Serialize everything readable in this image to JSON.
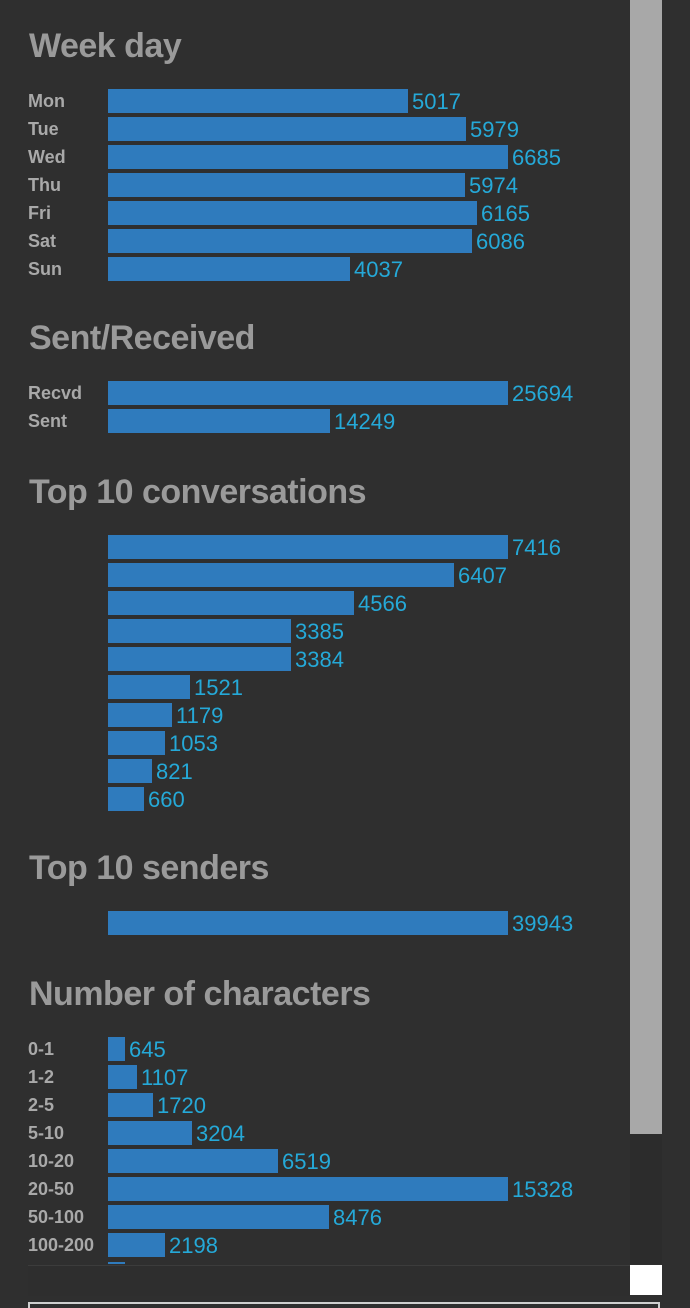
{
  "chart_data": [
    {
      "type": "bar",
      "title": "Week day",
      "categories": [
        "Mon",
        "Tue",
        "Wed",
        "Thu",
        "Fri",
        "Sat",
        "Sun"
      ],
      "values": [
        5017,
        5979,
        6685,
        5974,
        6165,
        6086,
        4037
      ],
      "bar_color": "#2f7bbd",
      "value_color": "#25a9d8"
    },
    {
      "type": "bar",
      "title": "Sent/Received",
      "categories": [
        "Recvd",
        "Sent"
      ],
      "values": [
        25694,
        14249
      ],
      "bar_color": "#2f7bbd",
      "value_color": "#25a9d8"
    },
    {
      "type": "bar",
      "title": "Top 10 conversations",
      "categories": [
        "",
        "",
        "",
        "",
        "",
        "",
        "",
        "",
        "",
        ""
      ],
      "values": [
        7416,
        6407,
        4566,
        3385,
        3384,
        1521,
        1179,
        1053,
        821,
        660
      ],
      "bar_color": "#2f7bbd",
      "value_color": "#25a9d8"
    },
    {
      "type": "bar",
      "title": "Top 10 senders",
      "categories": [
        ""
      ],
      "values": [
        39943
      ],
      "bar_color": "#2f7bbd",
      "value_color": "#25a9d8"
    },
    {
      "type": "bar",
      "title": "Number of characters",
      "categories": [
        "0-1",
        "1-2",
        "2-5",
        "5-10",
        "10-20",
        "20-50",
        "50-100",
        "100-200"
      ],
      "values": [
        645,
        1107,
        1720,
        3204,
        6519,
        15328,
        8476,
        2198
      ],
      "bar_color": "#2f7bbd",
      "value_color": "#25a9d8"
    }
  ],
  "colors": {
    "background": "#2f2f2f",
    "title": "#9a9a9a",
    "label": "#a9a9a9",
    "scrollbar_thumb": "#a8a8a8"
  }
}
